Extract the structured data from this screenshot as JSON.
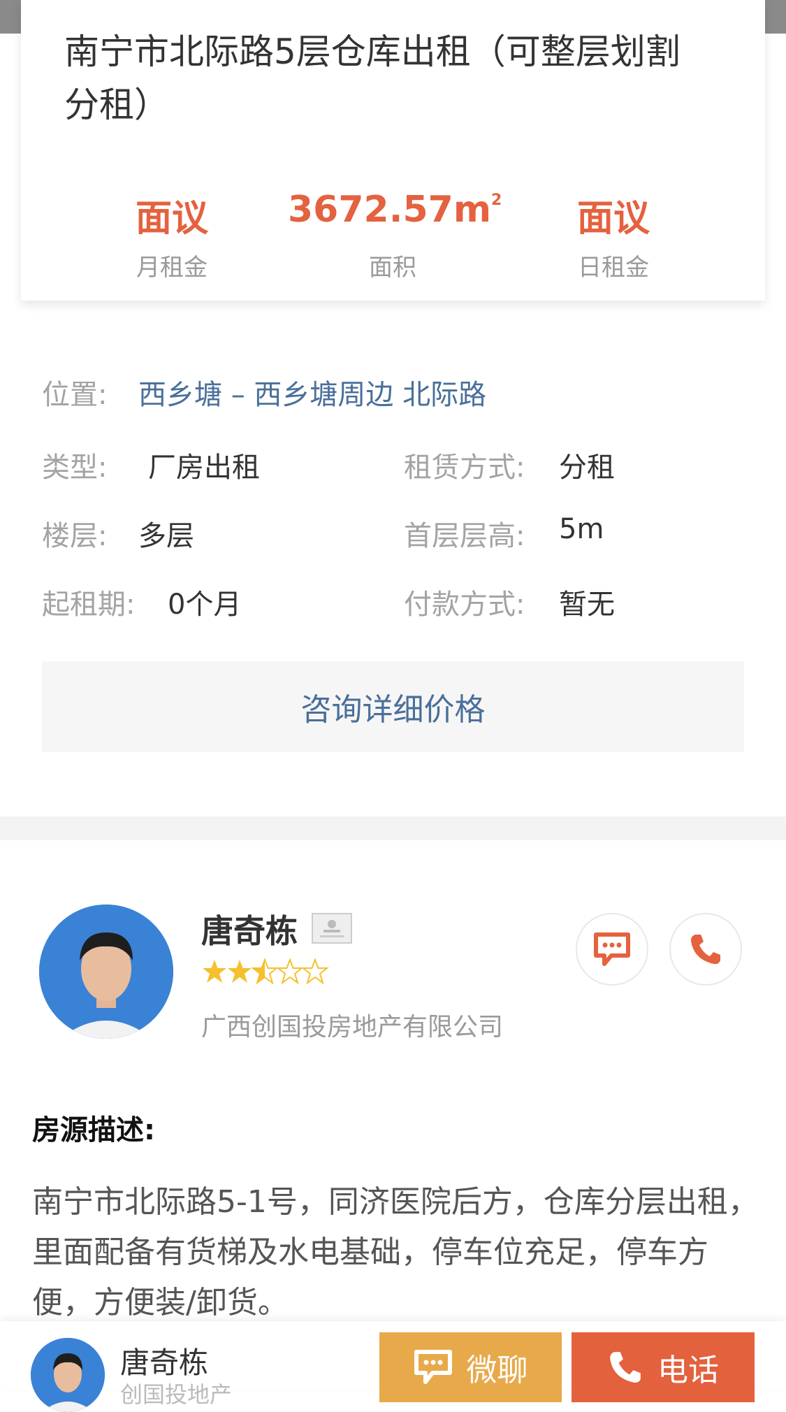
{
  "listing": {
    "title": "南宁市北际路5层仓库出租（可整层划割分租）",
    "stats": [
      {
        "value": "面议",
        "label": "月租金"
      },
      {
        "value": "3672.57m",
        "unit_sup": "2",
        "label": "面积"
      },
      {
        "value": "面议",
        "label": "日租金"
      }
    ]
  },
  "details": {
    "location_label": "位置:",
    "location_value": "西乡塘 – 西乡塘周边 北际路",
    "type_label": "类型:",
    "type_value": "厂房出租",
    "lease_label": "租赁方式:",
    "lease_value": "分租",
    "floor_label": "楼层:",
    "floor_value": "多层",
    "height_label": "首层层高:",
    "height_value": "5m",
    "start_label": "起租期:",
    "start_value": "0个月",
    "pay_label": "付款方式:",
    "pay_value": "暂无",
    "consult_label": "咨询详细价格"
  },
  "agent": {
    "name": "唐奇栋",
    "rating": 2.5,
    "rating_max": 5,
    "company": "广西创国投房地产有限公司"
  },
  "description": {
    "heading": "房源描述:",
    "text": "南宁市北际路5-1号，同济医院后方，仓库分层出租，里面配备有货梯及水电基础，停车位充足，停车方便，方便装/卸货。"
  },
  "bottom_bar": {
    "name": "唐奇栋",
    "subtitle": "创国投地产",
    "chat_label": "微聊",
    "call_label": "电话"
  },
  "colors": {
    "accent": "#e4623f",
    "link": "#4a6f9a",
    "chat_button": "#e8a94a",
    "call_button": "#e3613d",
    "star": "#f5c02e"
  }
}
